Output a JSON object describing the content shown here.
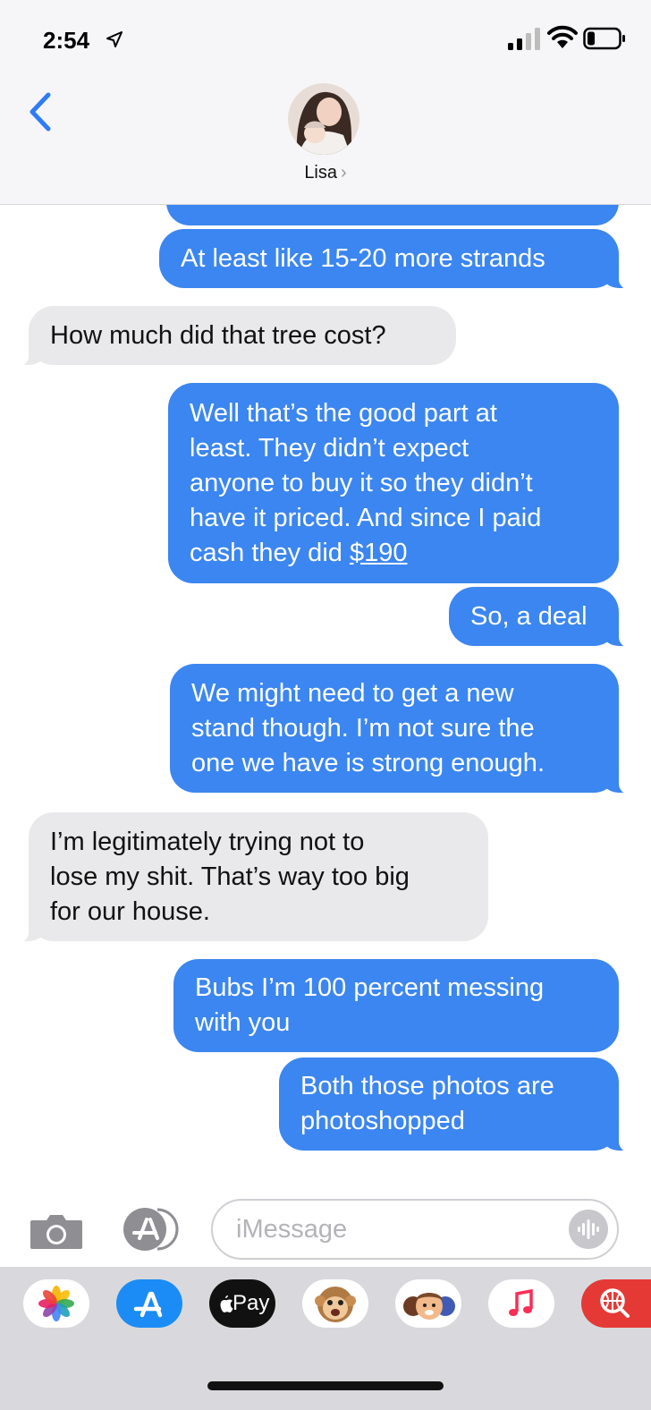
{
  "status_bar": {
    "time": "2:54"
  },
  "header": {
    "contact_name": "Lisa",
    "chevron": "›"
  },
  "messages": [
    {
      "from": "me",
      "lines": [
        "At least like 15-20 more strands"
      ]
    },
    {
      "from": "them",
      "lines": [
        "How much did that tree cost?"
      ]
    },
    {
      "from": "me",
      "lines": [
        "Well that’s the good part at",
        "least. They didn’t expect",
        "anyone to buy it so they didn’t",
        "have it priced. And since I paid",
        "cash they did "
      ],
      "link": "$190"
    },
    {
      "from": "me",
      "lines": [
        "So, a deal"
      ]
    },
    {
      "from": "me",
      "lines": [
        "We might need to get a new",
        "stand though. I’m not sure the",
        "one we have is strong enough."
      ]
    },
    {
      "from": "them",
      "lines": [
        "I’m legitimately trying not to",
        "lose my shit. That’s way too big",
        "for our house."
      ]
    },
    {
      "from": "me",
      "lines": [
        "Bubs I’m 100 percent messing",
        "with you"
      ]
    },
    {
      "from": "me",
      "lines": [
        "Both those photos are",
        "photoshopped"
      ]
    }
  ],
  "compose": {
    "placeholder": "iMessage"
  },
  "app_drawer": {
    "apps": [
      "photos-icon",
      "app-store-icon",
      "apple-pay-icon",
      "animoji-icon",
      "memoji-icon",
      "music-icon",
      "web-search-icon"
    ],
    "apple_pay_label": "Pay"
  },
  "colors": {
    "sent": "#3b86f0",
    "received": "#e9e9eb",
    "accent": "#2f7cf6"
  }
}
